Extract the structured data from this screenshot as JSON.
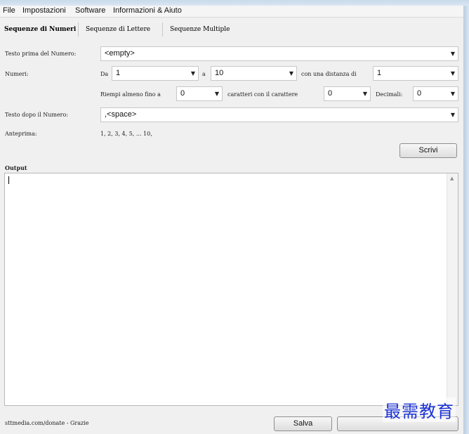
{
  "menu": {
    "file": "File",
    "impostazioni": "Impostazioni",
    "software": "Software",
    "informazioni": "Informazioni & Aiuto"
  },
  "tabs": {
    "numeri": "Sequenze di Numeri",
    "lettere": "Sequenze di Lettere",
    "multiple": "Sequenze Multiple"
  },
  "form": {
    "testo_prima_label": "Testo prima del Numero:",
    "testo_prima_value": "<empty>",
    "numeri_label": "Numeri:",
    "da_label": "Da",
    "da_value": "1",
    "a_label": "a",
    "a_value": "10",
    "distanza_label": "con una distanza di",
    "distanza_value": "1",
    "riempi_label": "Riempi almeno fino a",
    "riempi_value": "0",
    "caratteri_label": "caratteri con il carattere",
    "carattere_value": "0",
    "decimali_label": "Decimali:",
    "decimali_value": "0",
    "testo_dopo_label": "Testo dopo il Numero:",
    "testo_dopo_value": ",<space>",
    "anteprima_label": "Anteprima:",
    "anteprima_value": "1, 2, 3, 4, 5, ... 10,"
  },
  "buttons": {
    "scrivi": "Scrivi",
    "salva": "Salva",
    "secondary": ""
  },
  "output": {
    "label": "Output",
    "text": ""
  },
  "footer": {
    "donate_text": "sttmedia.com/donate - Grazie"
  },
  "watermark": {
    "text": "最需教育"
  },
  "colors": {
    "window_bg": "#f0f0f0",
    "frame": "#d7e3ef",
    "watermark": "#1c33d4"
  }
}
